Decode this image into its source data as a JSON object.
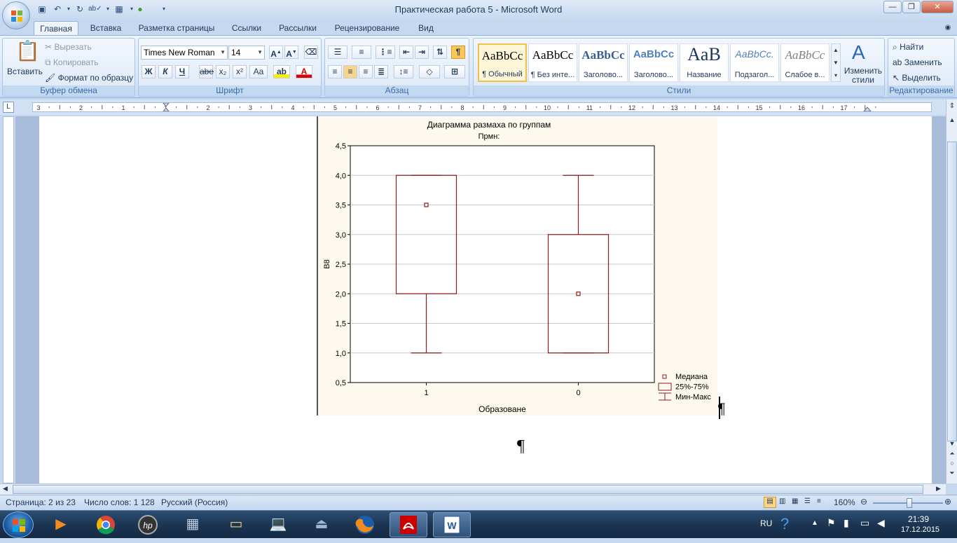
{
  "window": {
    "title": "Практическая работа 5 - Microsoft Word"
  },
  "tabs": [
    {
      "label": "Главная",
      "active": true
    },
    {
      "label": "Вставка"
    },
    {
      "label": "Разметка страницы"
    },
    {
      "label": "Ссылки"
    },
    {
      "label": "Рассылки"
    },
    {
      "label": "Рецензирование"
    },
    {
      "label": "Вид"
    }
  ],
  "clipboard": {
    "paste": "Вставить",
    "cut": "Вырезать",
    "copy": "Копировать",
    "format_painter": "Формат по образцу",
    "group_label": "Буфер обмена"
  },
  "font": {
    "family": "Times New Roman",
    "size": "14",
    "group_label": "Шрифт",
    "bold": "Ж",
    "italic": "К",
    "underline": "Ч",
    "strike": "abe",
    "sub": "x₂",
    "sup": "x²",
    "case": "Aa"
  },
  "paragraph": {
    "group_label": "Абзац"
  },
  "styles": {
    "group_label": "Стили",
    "items": [
      {
        "sample": "AaBbCc",
        "name": "¶ Обычный"
      },
      {
        "sample": "AaBbCc",
        "name": "¶ Без инте..."
      },
      {
        "sample": "AaBbCc",
        "name": "Заголово..."
      },
      {
        "sample": "AaBbCc",
        "name": "Заголово..."
      },
      {
        "sample": "AaB",
        "name": "Название"
      },
      {
        "sample": "AaBbCc.",
        "name": "Подзагол..."
      },
      {
        "sample": "AaBbCc",
        "name": "Слабое в..."
      }
    ],
    "change_styles": "Изменить стили"
  },
  "editing": {
    "find": "Найти",
    "replace": "Заменить",
    "select": "Выделить",
    "group_label": "Редактирование"
  },
  "ruler": {
    "numbers": [
      "3",
      "2",
      "1",
      "1",
      "2",
      "3",
      "4",
      "5",
      "6",
      "7",
      "8",
      "9",
      "10",
      "11",
      "12",
      "13",
      "14",
      "15",
      "16",
      "17"
    ]
  },
  "chart_data": {
    "type": "boxplot",
    "title": "Диаграмма размаха по группам",
    "subtitle": "Прмн:",
    "xlabel": "Образоване",
    "ylabel": "В8",
    "ylim": [
      0.5,
      4.5
    ],
    "yticks": [
      "0,5",
      "1,0",
      "1,5",
      "2,0",
      "2,5",
      "3,0",
      "3,5",
      "4,0",
      "4,5"
    ],
    "categories": [
      "1",
      "0"
    ],
    "boxes": [
      {
        "category": "1",
        "median": 3.5,
        "q1": 2.0,
        "q3": 4.0,
        "min": 1.0,
        "max": 4.0
      },
      {
        "category": "0",
        "median": 2.0,
        "q1": 1.0,
        "q3": 3.0,
        "min": 1.0,
        "max": 4.0
      }
    ],
    "legend": [
      "Медиана",
      "25%-75%",
      "Мин-Макс"
    ],
    "legend_position": "bottom-right",
    "grid": true,
    "color": "#8b1a1a"
  },
  "document": {
    "pilcrow": "¶"
  },
  "status": {
    "page": "Страница: 2 из 23",
    "words": "Число слов: 1 128",
    "language": "Русский (Россия)",
    "zoom": "160%"
  },
  "taskbar": {
    "lang": "RU",
    "time": "21:39",
    "date": "17.12.2015"
  }
}
